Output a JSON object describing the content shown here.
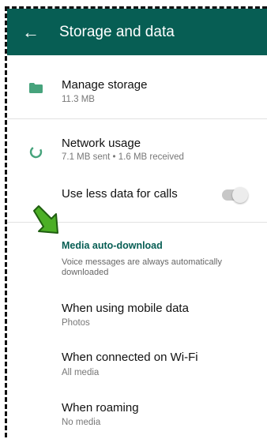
{
  "appbar": {
    "title": "Storage and data",
    "back_icon": "arrow-left-icon",
    "color": "#075e54"
  },
  "storage": {
    "icon": "folder-icon",
    "title": "Manage storage",
    "subtitle": "11.3 MB"
  },
  "network": {
    "icon": "network-usage-icon",
    "title": "Network usage",
    "subtitle": "7.1 MB sent • 1.6 MB received"
  },
  "calls": {
    "title": "Use less data for calls",
    "toggle_on": false
  },
  "media": {
    "header": "Media auto-download",
    "note": "Voice messages are always automatically downloaded",
    "items": [
      {
        "title": "When using mobile data",
        "subtitle": "Photos"
      },
      {
        "title": "When connected on Wi-Fi",
        "subtitle": "All media"
      },
      {
        "title": "When roaming",
        "subtitle": "No media"
      }
    ]
  },
  "annotation": {
    "icon": "green-arrow-icon",
    "color": "#4caf26"
  }
}
